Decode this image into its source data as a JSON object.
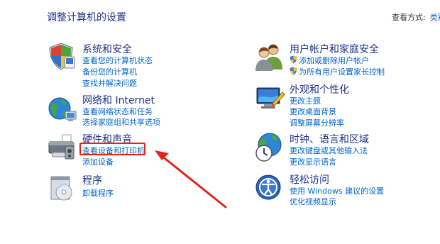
{
  "header": {
    "title": "调整计算机的设置",
    "view_by_label": "查看方式:",
    "view_by_value": "类别"
  },
  "categories": [
    {
      "title": "系统和安全",
      "links": [
        "查看您的计算机状态",
        "备份您的计算机",
        "查找并解决问题"
      ]
    },
    {
      "title": "网络和 Internet",
      "links": [
        "查看网络状态和任务",
        "选择家庭组和共享选项"
      ]
    },
    {
      "title": "硬件和声音",
      "links": [
        "查看设备和打印机",
        "添加设备"
      ]
    },
    {
      "title": "程序",
      "links": [
        "卸载程序"
      ]
    },
    {
      "title": "用户帐户和家庭安全",
      "links": [
        "添加或删除用户帐户",
        "为所有用户设置家长控制"
      ]
    },
    {
      "title": "外观和个性化",
      "links": [
        "更改主题",
        "更改桌面背景",
        "调整屏幕分辨率"
      ]
    },
    {
      "title": "时钟、语言和区域",
      "links": [
        "更改键盘或其他输入法",
        "更改显示语言"
      ]
    },
    {
      "title": "轻松访问",
      "links": [
        "使用 Windows 建议的设置",
        "优化视频显示"
      ]
    }
  ],
  "colors": {
    "title": "#1e3287",
    "link": "#0066cc",
    "annotation": "#e3241b"
  }
}
